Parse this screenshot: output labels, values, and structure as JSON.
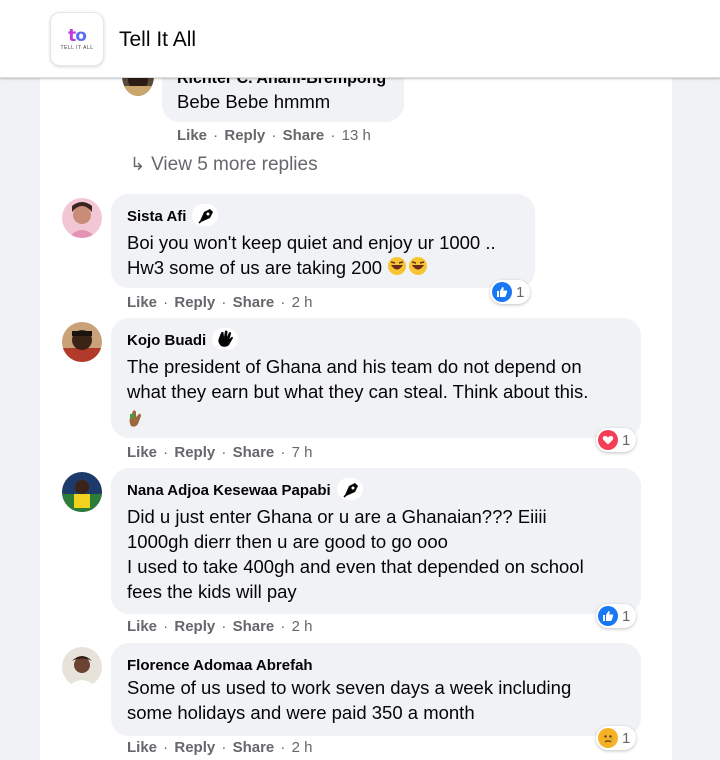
{
  "header": {
    "title": "Tell It All",
    "logo_text": "TELL IT ALL"
  },
  "top_reply": {
    "author": "Richter C. Anani-Brempong",
    "text": "Bebe Bebe hmmm",
    "like": "Like",
    "reply": "Reply",
    "share": "Share",
    "time": "13 h"
  },
  "view_more_replies": "View 5 more replies",
  "comments": [
    {
      "author": "Sista Afi",
      "badge_icon": "fountain-pen-icon",
      "lines": [
        "Boi you won't keep quiet and enjoy ur 1000 ..",
        "Hw3 some of us are taking 200"
      ],
      "like": "Like",
      "reply": "Reply",
      "share": "Share",
      "time": "2 h",
      "reaction": {
        "type": "like",
        "count": "1"
      }
    },
    {
      "author": "Kojo Buadi",
      "badge_icon": "waving-hand-icon",
      "lines": [
        "The president of Ghana and his team do not depend on",
        "what they earn but what they can steal. Think about this."
      ],
      "like": "Like",
      "reply": "Reply",
      "share": "Share",
      "time": "7 h",
      "reaction": {
        "type": "love",
        "count": "1"
      }
    },
    {
      "author": "Nana Adjoa Kesewaa Papabi",
      "badge_icon": "fountain-pen-icon",
      "lines": [
        "Did u just enter Ghana or u are a Ghanaian??? Eiiii",
        "1000gh dierr then u are good to go ooo",
        "I used to take 400gh and even that depended on school",
        "fees the kids will pay"
      ],
      "like": "Like",
      "reply": "Reply",
      "share": "Share",
      "time": "2 h",
      "reaction": {
        "type": "like",
        "count": "1"
      }
    },
    {
      "author": "Florence Adomaa Abrefah",
      "lines": [
        "Some of us used to work seven days a week including",
        "some holidays and were paid 350 a month"
      ],
      "like": "Like",
      "reply": "Reply",
      "share": "Share",
      "time": "2 h",
      "reaction": {
        "type": "sad",
        "count": "1"
      }
    }
  ],
  "colors": {
    "like_blue": "#1877f2",
    "love_red": "#f33e58",
    "sad_yellow": "#f7b125",
    "bubble_gray": "#f0f2f5",
    "meta_gray": "#65676b"
  }
}
